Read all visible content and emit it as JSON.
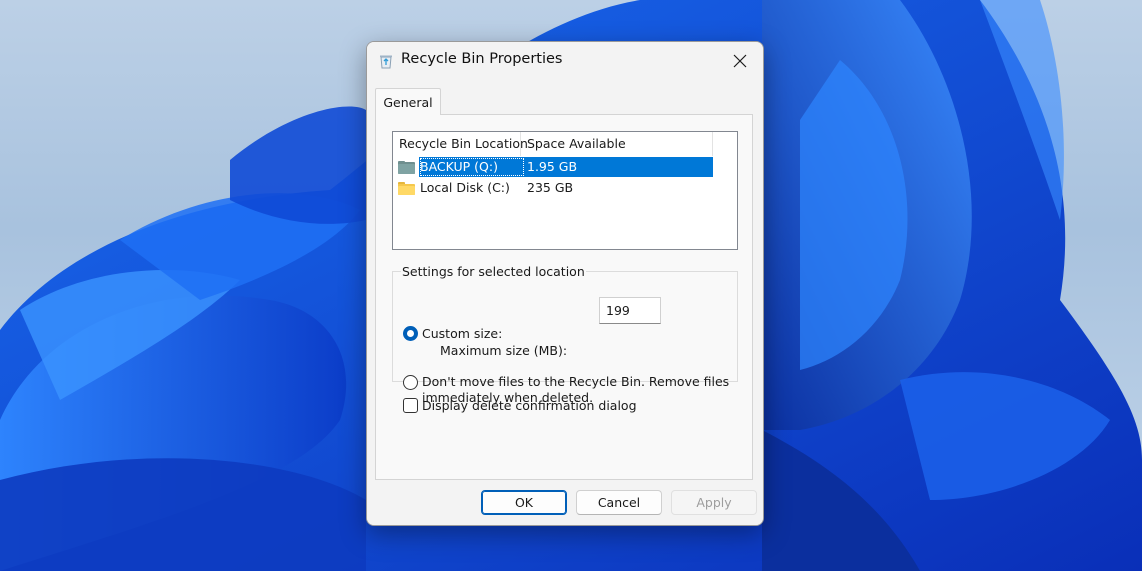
{
  "dialog": {
    "title": "Recycle Bin Properties",
    "icon": "recycle-bin-icon"
  },
  "tabs": [
    {
      "label": "General",
      "selected": true
    }
  ],
  "locations": {
    "columns": [
      "Recycle Bin Location",
      "Space Available"
    ],
    "rows": [
      {
        "name": "BACKUP (Q:)",
        "space": "1.95 GB",
        "icon": "drive-icon",
        "selected": true
      },
      {
        "name": "Local Disk (C:)",
        "space": "235 GB",
        "icon": "folder-icon",
        "selected": false
      }
    ]
  },
  "settings": {
    "group_title": "Settings for selected location",
    "custom_size_label": "Custom size:",
    "custom_size_selected": true,
    "max_size_label": "Maximum size (MB):",
    "max_size_value": "199",
    "dont_move_label_line1": "Don't move files to the Recycle Bin. Remove files",
    "dont_move_label_line2": "immediately when deleted.",
    "dont_move_selected": false
  },
  "confirm_dialog": {
    "label": "Display delete confirmation dialog",
    "checked": false
  },
  "buttons": {
    "ok": "OK",
    "cancel": "Cancel",
    "apply": "Apply"
  },
  "colors": {
    "selection": "#0078d7",
    "accent": "#005fb8"
  }
}
